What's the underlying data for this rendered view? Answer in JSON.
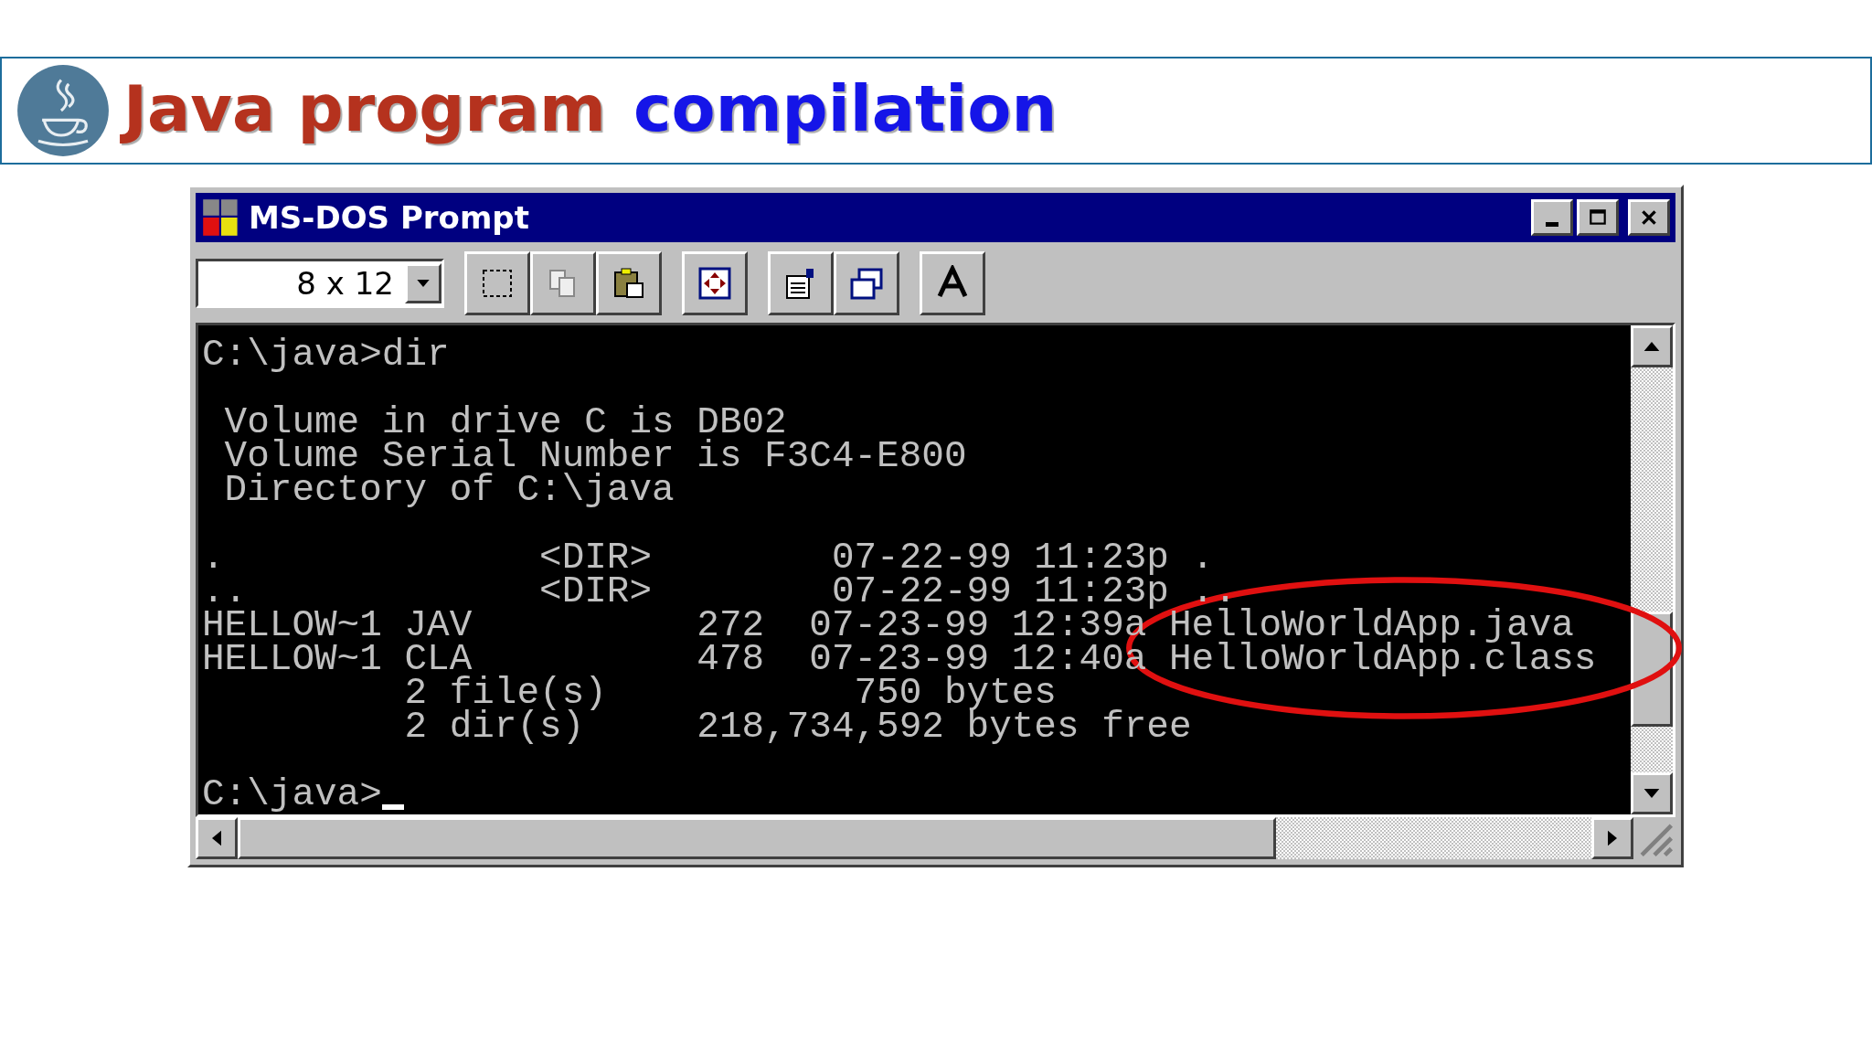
{
  "slide": {
    "title": [
      {
        "text": "Java program",
        "color": "#b5321e"
      },
      {
        "text": "compilation",
        "color": "#1515e8"
      }
    ]
  },
  "window": {
    "title": "MS-DOS Prompt",
    "font_size": "8 x 12"
  },
  "terminal": {
    "lines": [
      {
        "text": "C:\\java>dir",
        "blank_before": false
      },
      {
        "text": " Volume in drive C is DB02",
        "blank_before": true
      },
      {
        "text": " Volume Serial Number is F3C4-E800",
        "blank_before": false
      },
      {
        "text": " Directory of C:\\java",
        "blank_before": false
      },
      {
        "text": ".              <DIR>        07-22-99 11:23p .",
        "blank_before": true
      },
      {
        "text": "..             <DIR>        07-22-99 11:23p ..",
        "blank_before": false
      },
      {
        "text": "HELLOW~1 JAV          272  07-23-99 12:39a HelloWorldApp.java",
        "blank_before": false
      },
      {
        "text": "HELLOW~1 CLA          478  07-23-99 12:40a HelloWorldApp.class",
        "blank_before": false
      },
      {
        "text": "         2 file(s)           750 bytes",
        "blank_before": false
      },
      {
        "text": "         2 dir(s)     218,734,592 bytes free",
        "blank_before": false
      },
      {
        "text": "C:\\java>",
        "blank_before": true
      }
    ]
  }
}
